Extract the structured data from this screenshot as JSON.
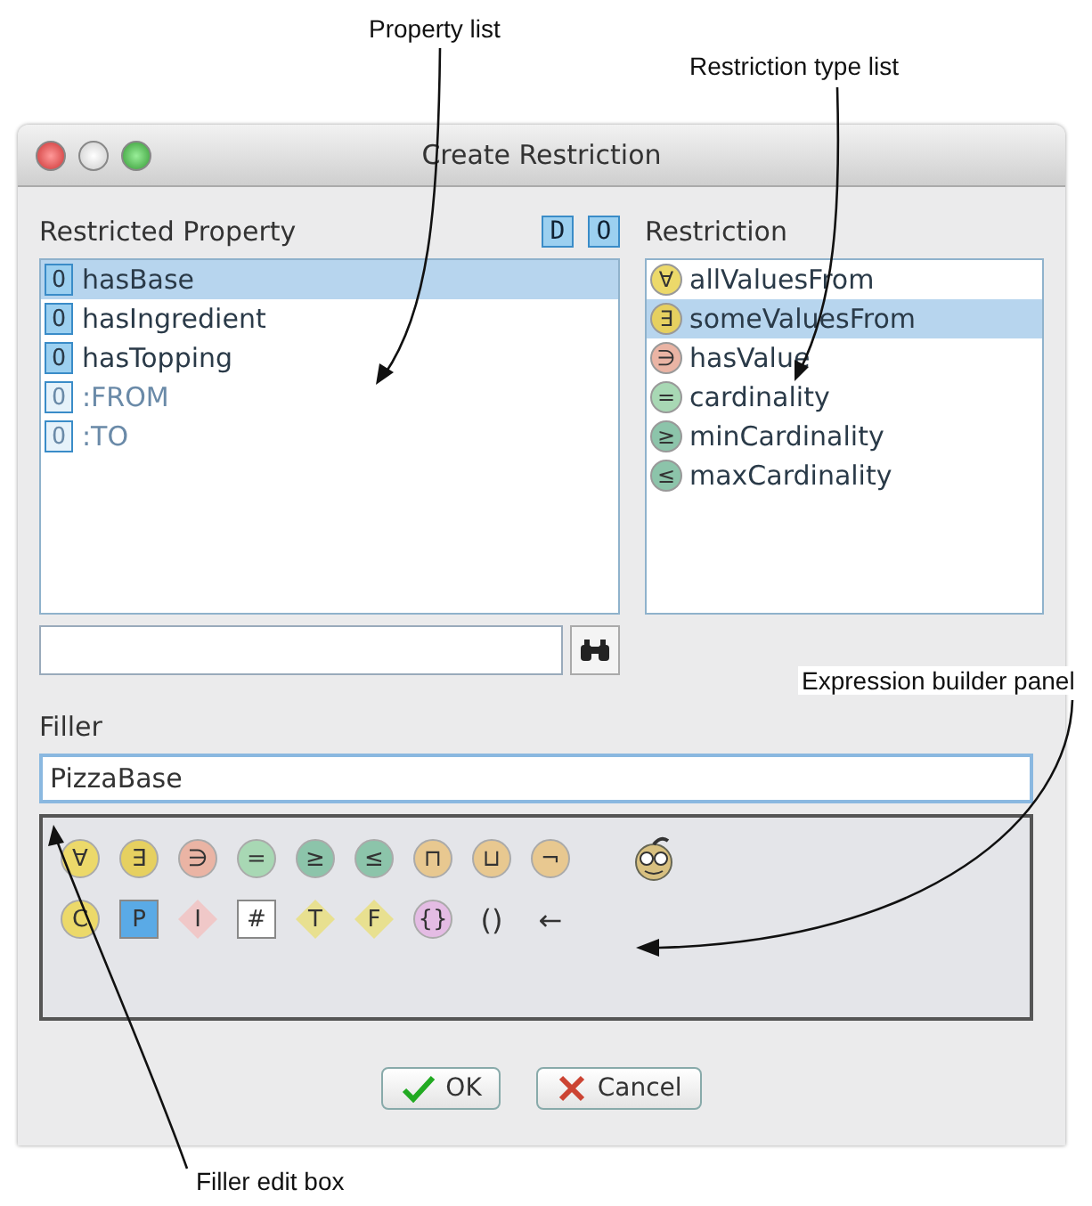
{
  "annotations": [
    {
      "text": "Property list"
    },
    {
      "text": "Restriction type list"
    },
    {
      "text": "Expression builder panel"
    },
    {
      "text": "Filler edit box"
    }
  ],
  "window": {
    "title": "Create Restriction"
  },
  "property_panel": {
    "label": "Restricted Property",
    "tool_buttons": [
      "D",
      "O"
    ],
    "items": [
      {
        "icon": "O",
        "label": "hasBase",
        "kind": "user",
        "selected": true
      },
      {
        "icon": "O",
        "label": "hasIngredient",
        "kind": "user",
        "selected": false
      },
      {
        "icon": "O",
        "label": "hasTopping",
        "kind": "user",
        "selected": false
      },
      {
        "icon": "O",
        "label": ":FROM",
        "kind": "system",
        "selected": false
      },
      {
        "icon": "O",
        "label": ":TO",
        "kind": "system",
        "selected": false
      }
    ]
  },
  "restriction_panel": {
    "label": "Restriction",
    "items": [
      {
        "symbol": "∀",
        "label": "allValuesFrom",
        "color": "#ecd96a",
        "selected": false
      },
      {
        "symbol": "∃",
        "label": "someValuesFrom",
        "color": "#e6d060",
        "selected": true
      },
      {
        "symbol": "∋",
        "label": "hasValue",
        "color": "#eab4a4",
        "selected": false
      },
      {
        "symbol": "=",
        "label": "cardinality",
        "color": "#a8d8b4",
        "selected": false
      },
      {
        "symbol": "≥",
        "label": "minCardinality",
        "color": "#8cc4aa",
        "selected": false
      },
      {
        "symbol": "≤",
        "label": "maxCardinality",
        "color": "#8cc4aa",
        "selected": false
      }
    ]
  },
  "filler": {
    "label": "Filler",
    "value": "PizzaBase"
  },
  "builder": {
    "rows": [
      [
        {
          "symbol": "∀",
          "kind": "circle",
          "color": "#ecd96a"
        },
        {
          "symbol": "∃",
          "kind": "circle",
          "color": "#e6d060"
        },
        {
          "symbol": "∋",
          "kind": "circle",
          "color": "#eab4a4"
        },
        {
          "symbol": "=",
          "kind": "circle",
          "color": "#a8d8b4"
        },
        {
          "symbol": "≥",
          "kind": "circle",
          "color": "#8cc4aa"
        },
        {
          "symbol": "≤",
          "kind": "circle",
          "color": "#8cc4aa"
        },
        {
          "symbol": "⊓",
          "kind": "circle",
          "color": "#e8c890"
        },
        {
          "symbol": "⊔",
          "kind": "circle",
          "color": "#e8c890"
        },
        {
          "symbol": "¬",
          "kind": "circle",
          "color": "#e8c890"
        },
        {
          "kind": "face"
        }
      ],
      [
        {
          "symbol": "C",
          "kind": "circle",
          "color": "#ecd96a"
        },
        {
          "symbol": "P",
          "kind": "square",
          "color": "#5aaae6"
        },
        {
          "symbol": "I",
          "kind": "diamond",
          "color": "#f0c8c8"
        },
        {
          "symbol": "#",
          "kind": "square",
          "color": "#ffffff"
        },
        {
          "symbol": "T",
          "kind": "diamond",
          "color": "#e8e090"
        },
        {
          "symbol": "F",
          "kind": "diamond",
          "color": "#e8e090"
        },
        {
          "symbol": "{}",
          "kind": "circle",
          "color": "#e4bce4"
        },
        {
          "symbol": "()",
          "kind": "plain"
        },
        {
          "symbol": "←",
          "kind": "plain"
        }
      ]
    ]
  },
  "buttons": [
    {
      "label": "OK",
      "kind": "ok"
    },
    {
      "label": "Cancel",
      "kind": "cancel"
    }
  ]
}
